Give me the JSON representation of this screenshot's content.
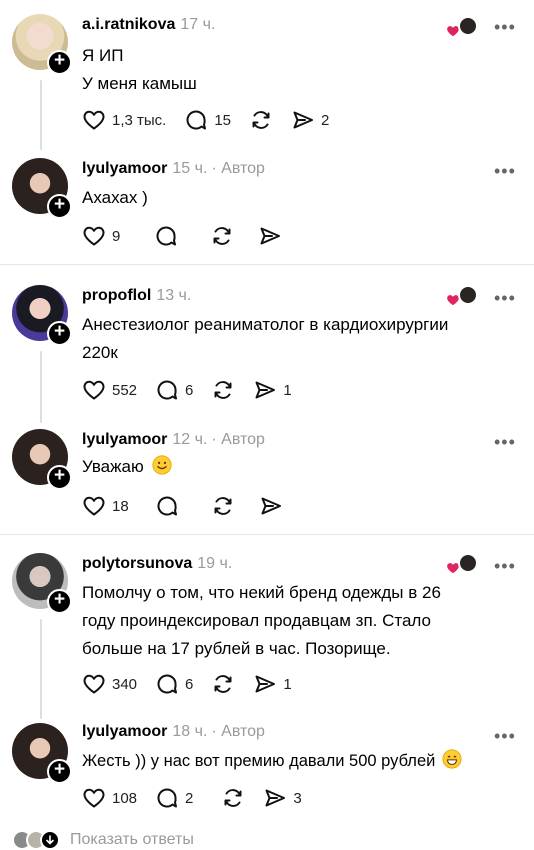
{
  "threads": [
    {
      "comment": {
        "username": "a.i.ratnikova",
        "time": "17 ч.",
        "lines": [
          "Я ИП",
          "У меня камыш"
        ],
        "likes": "1,3 тыс.",
        "replies": "15",
        "shares": "2"
      },
      "reply": {
        "username": "lyulyamoor",
        "time": "15 ч.",
        "author": "· Автор",
        "lines": [
          "Ахахах )"
        ],
        "likes": "9"
      }
    },
    {
      "comment": {
        "username": "propoflol",
        "time": "13 ч.",
        "lines": [
          "Анестезиолог реаниматолог в кардиохирургии",
          "220к"
        ],
        "likes": "552",
        "replies": "6",
        "shares": "1"
      },
      "reply": {
        "username": "lyulyamoor",
        "time": "12 ч.",
        "author": "· Автор",
        "lines": [
          "Уважаю"
        ],
        "likes": "18"
      }
    },
    {
      "comment": {
        "username": "polytorsunova",
        "time": "19 ч.",
        "lines": [
          "Помолчу о том, что некий бренд одежды в 26",
          "году проиндексировал продавцам зп. Стало",
          "больше на 17 рублей в час. Позорище."
        ],
        "likes": "340",
        "replies": "6",
        "shares": "1"
      },
      "reply": {
        "username": "lyulyamoor",
        "time": "18 ч.",
        "author": "· Автор",
        "lines": [
          "Жесть )) у нас вот премию давали 500 рублей"
        ],
        "likes": "108",
        "replies": "2",
        "shares": "3"
      }
    }
  ],
  "show_replies_label": "Показать ответы",
  "colors": {
    "heart": "#e0245e",
    "muted": "#9a9a9a",
    "divider": "#e6e6e6"
  },
  "icons": [
    "heart-icon",
    "comment-icon",
    "repost-icon",
    "share-icon",
    "plus-icon",
    "more-icon",
    "smile-emoji"
  ]
}
